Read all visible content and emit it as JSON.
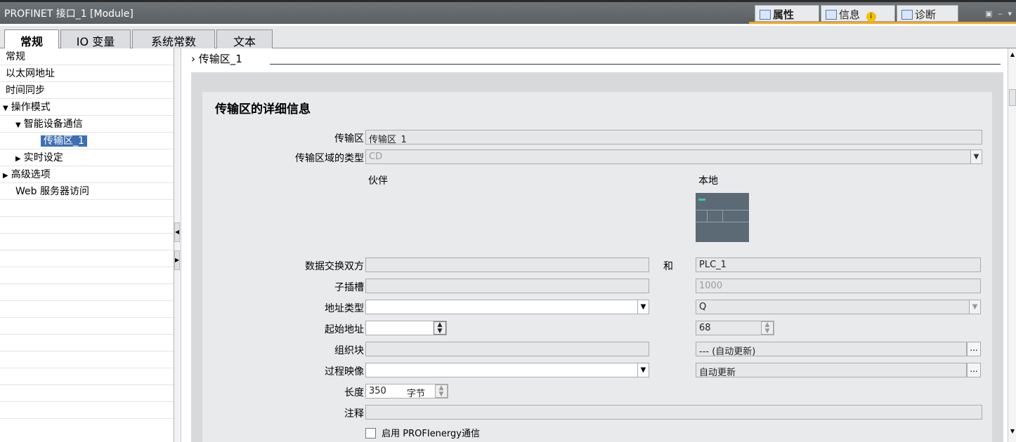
{
  "titlebar": {
    "title": "PROFINET 接口_1 [Module]",
    "tabs": [
      {
        "label": "属性",
        "icon": "properties-icon"
      },
      {
        "label": "信息",
        "icon": "info-icon"
      },
      {
        "label": "诊断",
        "icon": "diagnostics-icon"
      }
    ],
    "accent": "#f5a623"
  },
  "tabs": [
    "常规",
    "IO 变量",
    "系统常数",
    "文本"
  ],
  "sidebar": {
    "items": [
      {
        "label": "常规",
        "indent": 0,
        "arrow": ""
      },
      {
        "label": "以太网地址",
        "indent": 0,
        "arrow": ""
      },
      {
        "label": "时间同步",
        "indent": 0,
        "arrow": ""
      },
      {
        "label": "操作模式",
        "indent": 0,
        "arrow": "▼"
      },
      {
        "label": "智能设备通信",
        "indent": 1,
        "arrow": "▼"
      },
      {
        "label": "传输区_1",
        "indent": 2,
        "arrow": "",
        "selected": true
      },
      {
        "label": "实时设定",
        "indent": 1,
        "arrow": "▶"
      },
      {
        "label": "高级选项",
        "indent": 0,
        "arrow": "▶"
      },
      {
        "label": "Web 服务器访问",
        "indent": 0,
        "arrow": ""
      }
    ],
    "selected_color": "#3d6fb4"
  },
  "main": {
    "breadcrumb": "传输区_1",
    "section_title": "传输区的详细信息",
    "fields": {
      "transfer_area_label": "传输区",
      "transfer_area_value": "传输区_1",
      "area_type_label": "传输区域的类型",
      "area_type_value": "CD",
      "partner_header": "伙伴",
      "local_header": "本地",
      "exchange_label": "数据交换双方",
      "and_label": "和",
      "partner_exchange_value": "",
      "local_exchange_value": "PLC_1",
      "subslot_label": "子插槽",
      "partner_subslot_value": "",
      "local_subslot_value": "1000",
      "address_type_label": "地址类型",
      "partner_address_type_value": "",
      "local_address_type_value": "Q",
      "start_address_label": "起始地址",
      "partner_start_address_value": "",
      "local_start_address_value": "68",
      "ob_label": "组织块",
      "partner_ob_value": "",
      "local_ob_value": "--- (自动更新)",
      "process_image_label": "过程映像",
      "partner_process_image_value": "",
      "local_process_image_value": "自动更新",
      "length_label": "长度",
      "length_value": "350",
      "length_unit": "字节",
      "comment_label": "注释",
      "comment_value": "",
      "proenergy_label": "启用 PROFIenergy通信"
    }
  }
}
